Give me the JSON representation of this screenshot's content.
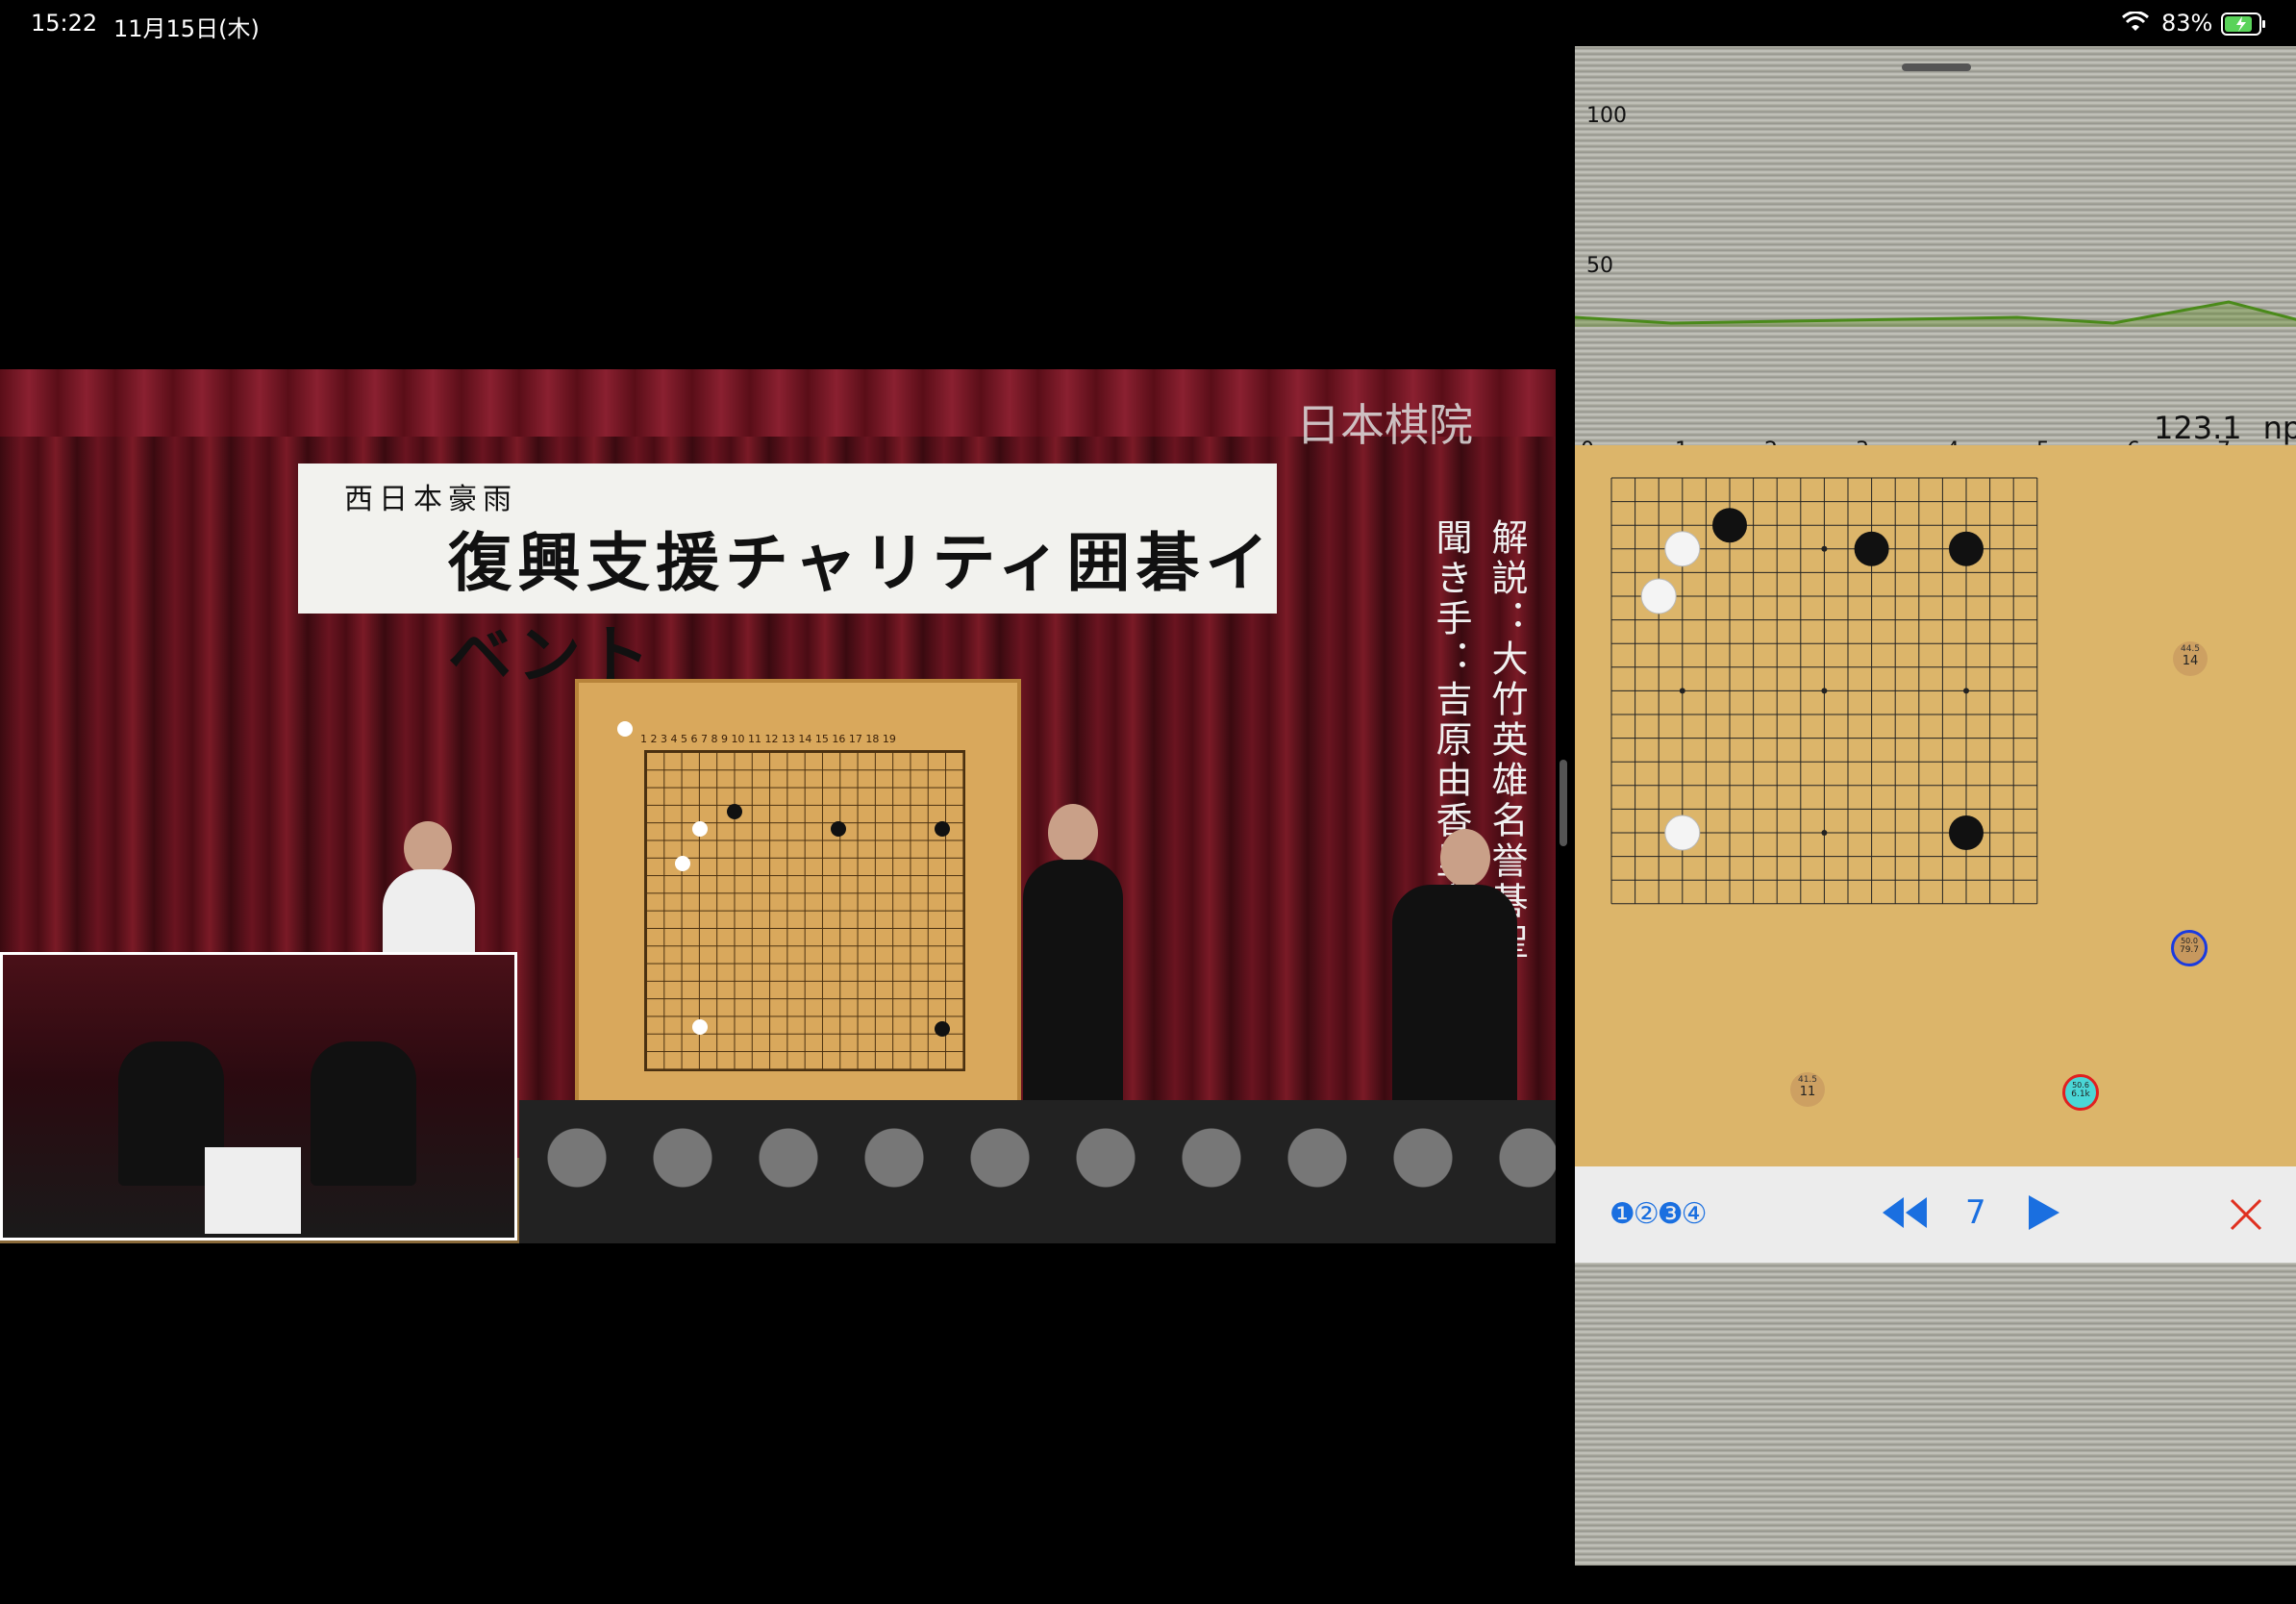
{
  "status_bar": {
    "time": "15:22",
    "date": "11月15日(木)",
    "battery": "83%"
  },
  "video": {
    "logo": "日本棋院",
    "banner_sub": "西日本豪雨",
    "banner_main": "復興支援チャリティ囲碁イベント",
    "commentator": "解説：大竹英雄名誉碁聖",
    "interviewer": "聞き手：吉原由香里六段",
    "board_numbers": "1 2 3 4 5 6 7 8 9 10 11 12 13 14 15 16 17 18 19"
  },
  "panel": {
    "graph": {
      "y_labels": [
        "100",
        "50"
      ]
    },
    "nps_value": "123.1",
    "nps_unit": "nps",
    "x_axis": [
      "0",
      "1",
      "2",
      "3",
      "4",
      "5",
      "6",
      "7"
    ],
    "board_markers": [
      {
        "winrate": "44.5",
        "visits": "14"
      },
      {
        "winrate": "41.5",
        "visits": "11"
      },
      {
        "winrate": "50.6",
        "visits": "6.1k"
      },
      {
        "winrate": "50.0",
        "visits": "79.7"
      }
    ],
    "toolbar": {
      "number_modes": "❶②❸④",
      "move_number": "7"
    },
    "colors": {
      "board": "#dcb56a",
      "accent": "#1a6fe0",
      "close": "#e03020",
      "graph_line": "#4a8a1a"
    }
  }
}
